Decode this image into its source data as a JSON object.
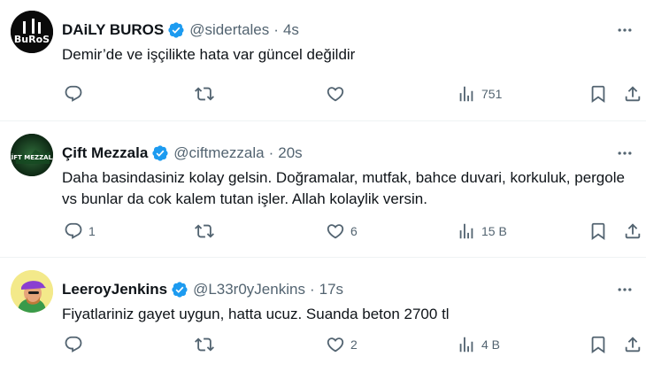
{
  "tweets": [
    {
      "name": "DAiLY BUROS",
      "handle": "@sidertales",
      "sep": "·",
      "time": "4s",
      "avatar_text": "BuRoS",
      "avatar_bg": "#0a0a0a",
      "text": "Demir’de ve işçilikte hata var güncel değildir",
      "reply_count": "",
      "retweet_count": "",
      "like_count": "",
      "views": "751"
    },
    {
      "name": "Çift Mezzala",
      "handle": "@ciftmezzala",
      "sep": "·",
      "time": "20s",
      "avatar_text": "ÇİFT MEZZALA",
      "avatar_bg": "#0d2414",
      "text": "Daha basindasiniz kolay gelsin. Doğramalar, mutfak, bahce duvari, korkuluk, pergole vs bunlar da cok kalem tutan işler. Allah kolaylik versin.",
      "reply_count": "1",
      "retweet_count": "",
      "like_count": "6",
      "views": "15 B"
    },
    {
      "name": "LeeroyJenkins",
      "handle": "@L33r0yJenkins",
      "sep": "·",
      "time": "17s",
      "avatar_text": "",
      "avatar_bg": "#f3e98a",
      "text": "Fiyatlariniz gayet uygun, hatta ucuz. Suanda beton 2700 tl",
      "reply_count": "",
      "retweet_count": "",
      "like_count": "2",
      "views": "4 B"
    }
  ],
  "colors": {
    "verified": "#1d9bf0",
    "muted": "#536471",
    "divider": "#eff3f4"
  },
  "icons": [
    "reply-icon",
    "retweet-icon",
    "like-icon",
    "views-icon",
    "bookmark-icon",
    "share-icon",
    "more-icon",
    "verified-badge-icon"
  ]
}
